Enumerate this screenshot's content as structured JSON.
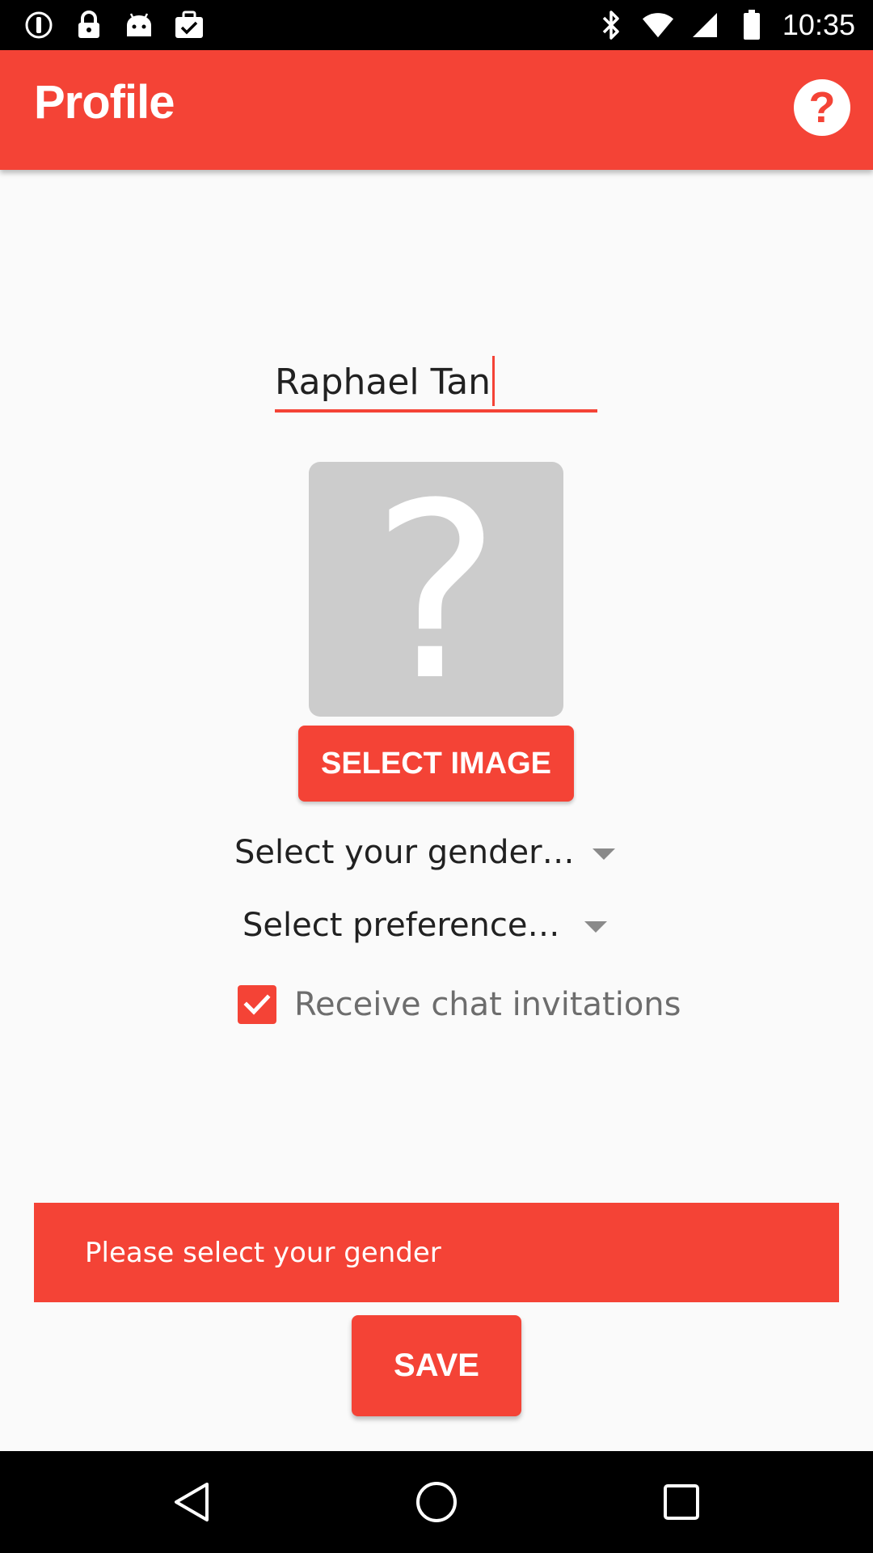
{
  "status_bar": {
    "time": "10:35",
    "left_icons": [
      "info-icon",
      "lock-icon",
      "android-icon",
      "clipboard-check-icon"
    ],
    "right_icons": [
      "bluetooth-icon",
      "wifi-icon",
      "cellular-icon",
      "battery-icon"
    ]
  },
  "app_bar": {
    "title": "Profile",
    "help_icon": "?",
    "accent_color": "#f44336"
  },
  "profile": {
    "name_value": "Raphael Tan",
    "image_placeholder_glyph": "?",
    "select_image_label": "SELECT IMAGE",
    "gender_spinner": "Select your gender…",
    "preference_spinner": "Select preference…",
    "chat_invitations_label": "Receive chat invitations",
    "chat_invitations_checked": true
  },
  "snackbar": {
    "message": "Please select your gender"
  },
  "actions": {
    "save_label": "SAVE"
  },
  "nav_bar": {
    "buttons": [
      "back-icon",
      "home-icon",
      "recents-icon"
    ]
  }
}
